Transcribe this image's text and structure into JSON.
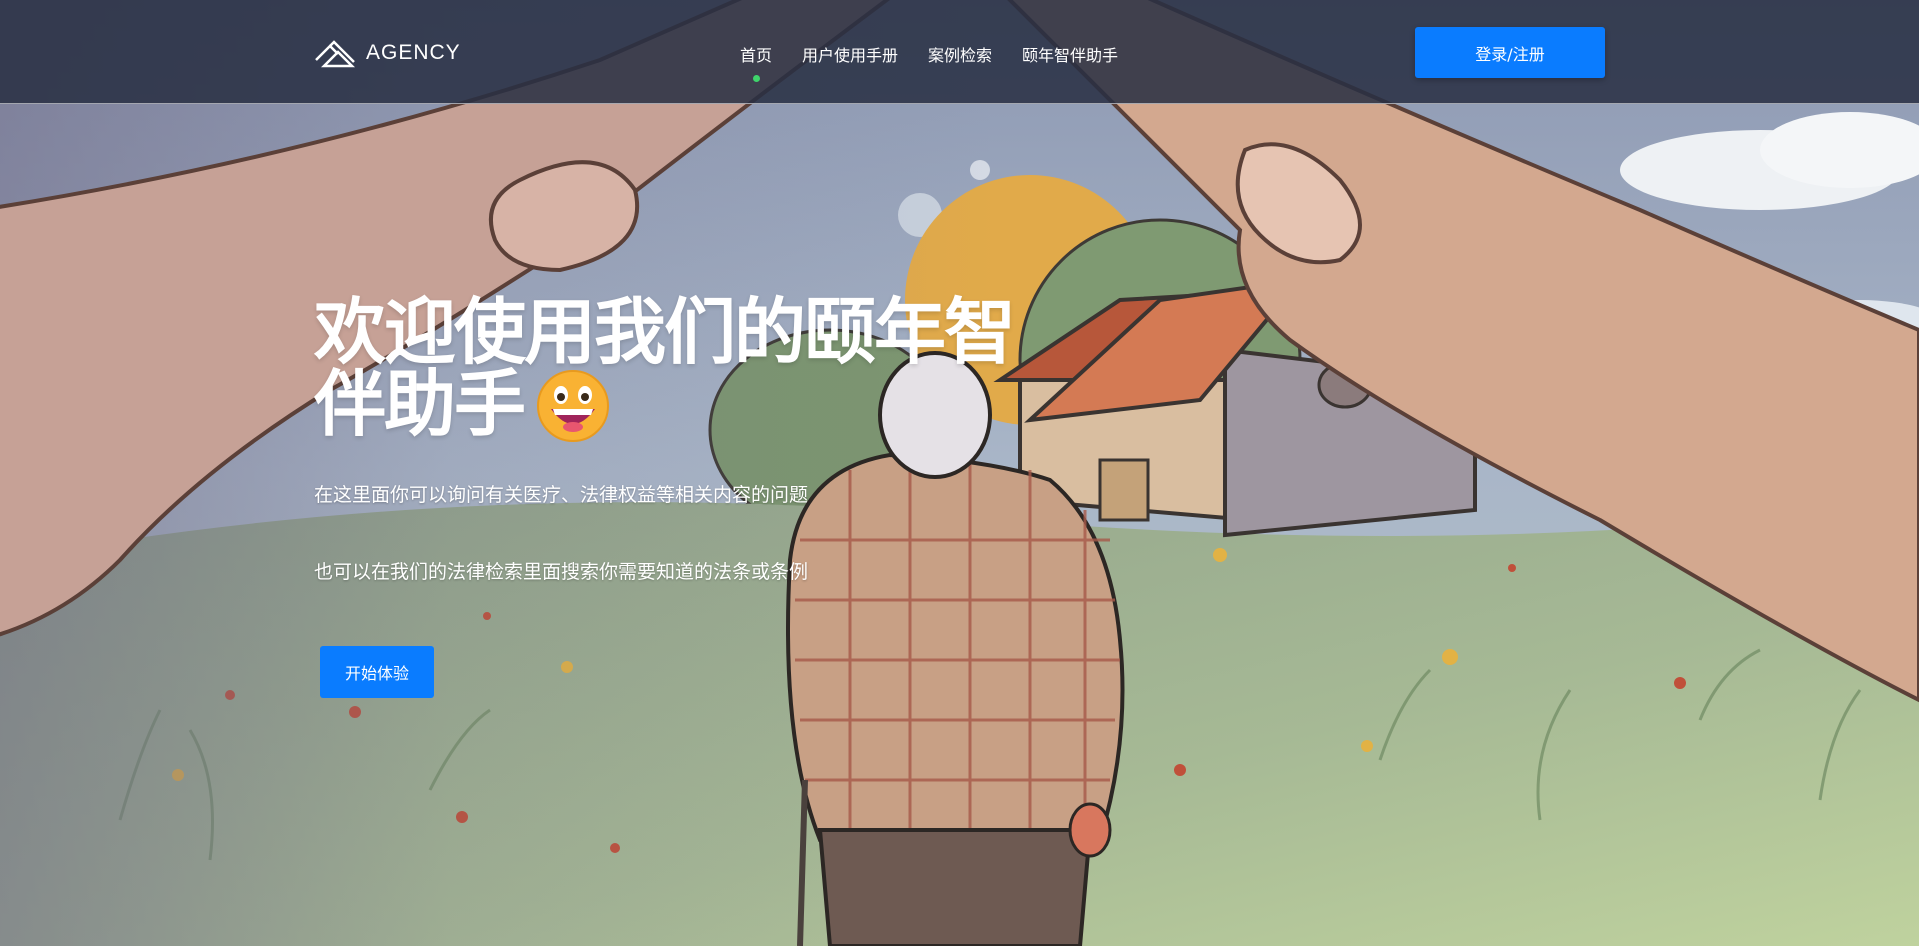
{
  "header": {
    "logo_text": "AGENCY",
    "nav": [
      {
        "label": "首页",
        "active": true
      },
      {
        "label": "用户使用手册",
        "active": false
      },
      {
        "label": "案例检索",
        "active": false
      },
      {
        "label": "颐年智伴助手",
        "active": false
      }
    ],
    "login_label": "登录/注册"
  },
  "hero": {
    "title": "欢迎使用我们的颐年智伴助手",
    "emoji_icon": "grinning-face-emoji",
    "subtitle_1": "在这里面你可以询问有关医疗、法律权益等相关内容的问题",
    "subtitle_2": "也可以在我们的法律检索里面搜索你需要知道的法条或条例",
    "cta_label": "开始体验",
    "background": "illustration-hands-sheltering-elderly-person-and-house"
  },
  "colors": {
    "accent": "#0a7cff",
    "active_dot": "#3fd46b",
    "header_bg": "#2d3447"
  }
}
